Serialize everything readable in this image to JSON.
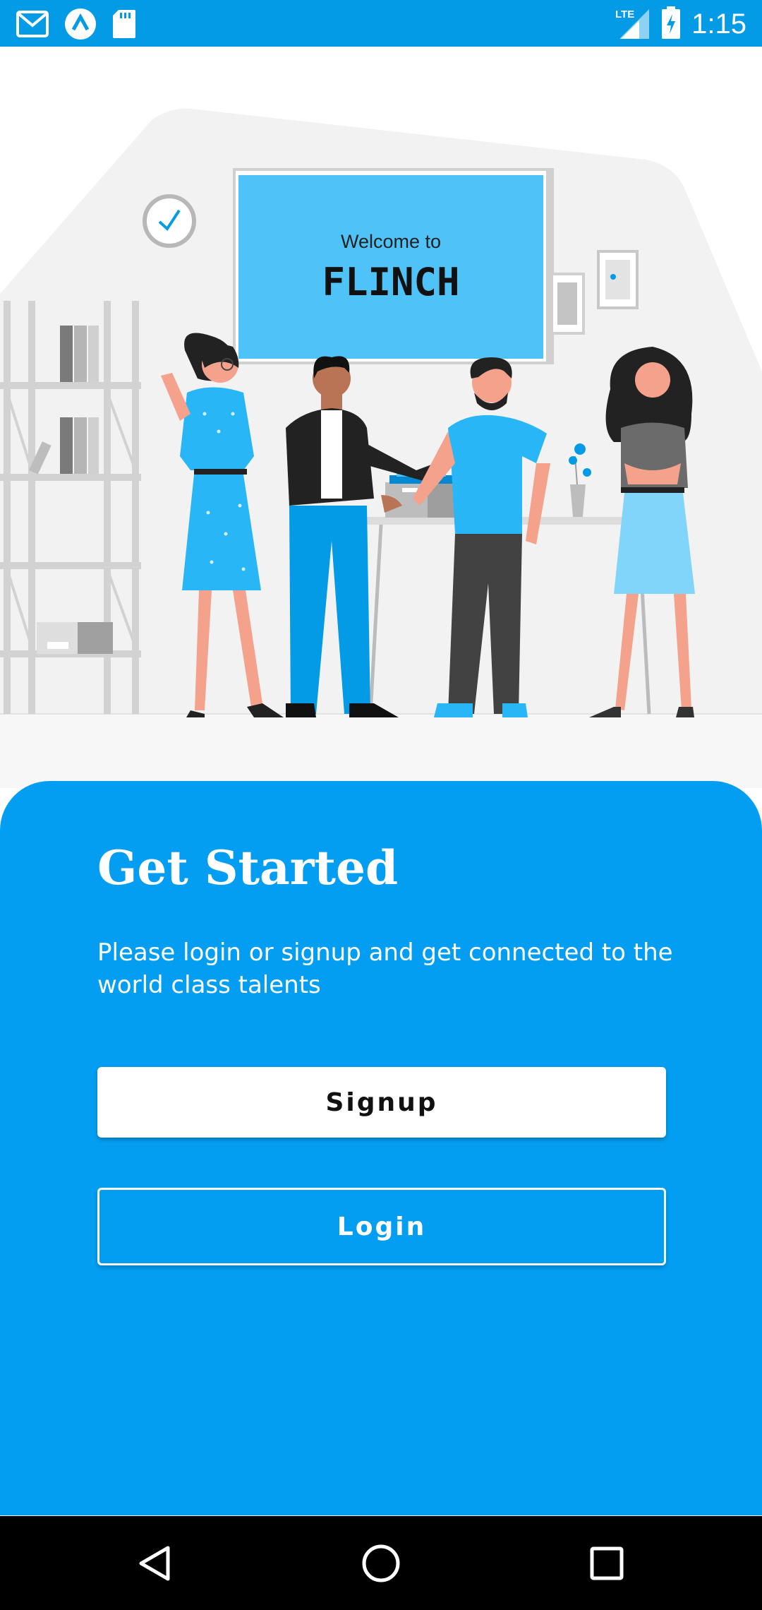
{
  "status_bar": {
    "time": "1:15",
    "network": "LTE",
    "icons": [
      "gmail-icon",
      "app-launcher-icon",
      "sd-card-icon",
      "lte-signal-icon",
      "battery-charging-icon"
    ]
  },
  "illustration": {
    "screen_welcome": "Welcome to",
    "screen_brand": "FLINCH"
  },
  "content": {
    "title": "Get Started",
    "subtitle": "Please login or signup and get connected to the world class talents",
    "signup_label": "Signup",
    "login_label": "Login"
  },
  "nav_bar": {
    "icons": [
      "back-icon",
      "home-icon",
      "recents-icon"
    ]
  },
  "colors": {
    "accent": "#039ef2",
    "status_bar": "#039be5",
    "nav_bar": "#000000",
    "button_text": "#111111"
  }
}
